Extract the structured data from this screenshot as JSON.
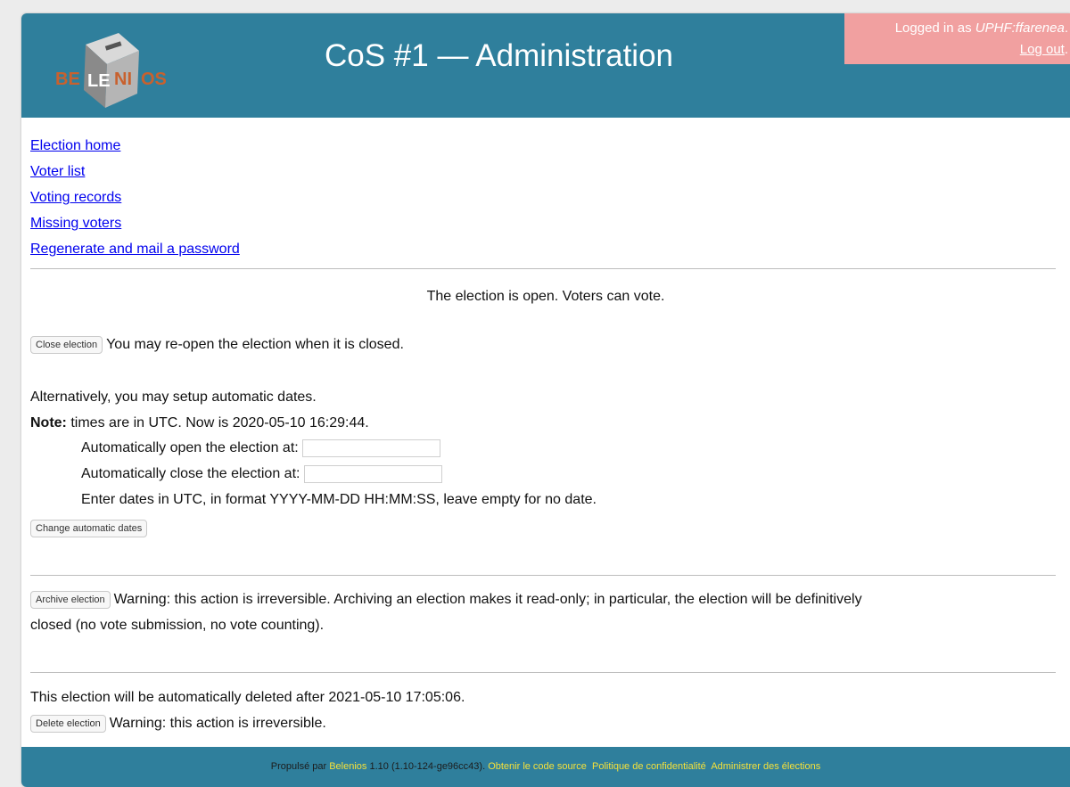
{
  "header": {
    "logo_text": "BELENIOS",
    "title": "CoS #1 — Administration",
    "logged_in_prefix": "Logged in as ",
    "user": "UPHF:ffarenea",
    "user_suffix": ".",
    "logout": "Log out",
    "logout_suffix": "."
  },
  "nav": [
    "Election home",
    "Voter list",
    "Voting records",
    "Missing voters",
    "Regenerate and mail a password"
  ],
  "status": "The election is open. Voters can vote.",
  "close": {
    "button": "Close election",
    "text": "You may re-open the election when it is closed."
  },
  "dates": {
    "intro": "Alternatively, you may setup automatic dates.",
    "note_label": "Note:",
    "note_text": " times are in UTC. Now is 2020-05-10 16:29:44.",
    "open_label": "Automatically open the election at:",
    "close_label": "Automatically close the election at:",
    "hint": "Enter dates in UTC, in format YYYY-MM-DD HH:MM:SS, leave empty for no date.",
    "button": "Change automatic dates"
  },
  "archive": {
    "button": "Archive election",
    "text_line1": "Warning: this action is irreversible. Archiving an election makes it read-only; in particular, the election will be definitively",
    "text_line2": "closed (no vote submission, no vote counting)."
  },
  "delete": {
    "info": "This election will be automatically deleted after 2021-05-10 17:05:06.",
    "button": "Delete election",
    "text": "Warning: this action is irreversible."
  },
  "footer": {
    "prefix": "Propulsé par ",
    "belenios": "Belenios",
    "version": " 1.10 (1.10-124-ge96cc43). ",
    "source": "Obtenir le code source",
    "privacy": "Politique de confidentialité",
    "admin": "Administrer des élections"
  },
  "colors": {
    "header_bg": "#2f7f9c",
    "login_bg": "#f1a0a0",
    "link": "#0000ee",
    "footer_link": "#f5e13a"
  }
}
